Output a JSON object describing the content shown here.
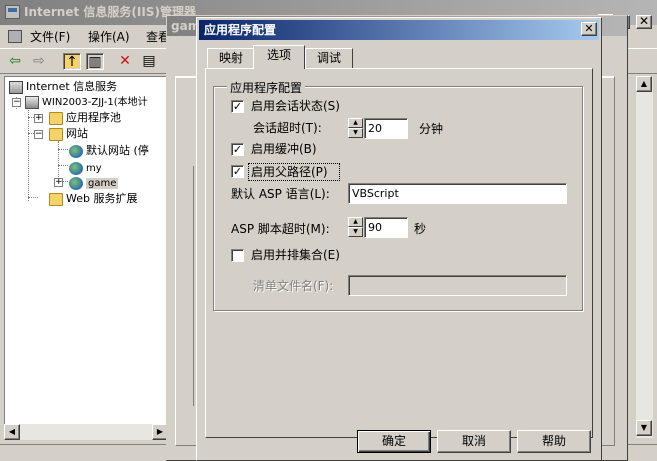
{
  "main_window": {
    "title": "Internet 信息服务(IIS)管理器",
    "menu": [
      "文件(F)",
      "操作(A)",
      "查看"
    ],
    "toolbar_icons": [
      "back-arrow-icon",
      "forward-arrow-icon",
      "up-folder-icon",
      "show-hide-tree-icon",
      "delete-icon",
      "properties-icon"
    ]
  },
  "tree": {
    "root": "Internet 信息服务",
    "server": "WIN2003-ZJJ-1(本地计",
    "app_pools": "应用程序池",
    "websites": "网站",
    "default_site": "默认网站 (停",
    "site_my": "my",
    "site_game": "game",
    "web_ext": "Web 服务扩展"
  },
  "bg_dialog": {
    "title": "game"
  },
  "dialog": {
    "title": "应用程序配置",
    "tabs": [
      "映射",
      "选项",
      "调试"
    ],
    "active_tab": "选项",
    "group_title": "应用程序配置",
    "session_state": {
      "label": "启用会话状态(S)",
      "checked": true
    },
    "session_timeout": {
      "label": "会话超时(T):",
      "value": "20",
      "unit": "分钟"
    },
    "buffering": {
      "label": "启用缓冲(B)",
      "checked": true
    },
    "parent_paths": {
      "label": "启用父路径(P)",
      "checked": true
    },
    "default_language": {
      "label": "默认 ASP 语言(L):",
      "value": "VBScript"
    },
    "script_timeout": {
      "label": "ASP 脚本超时(M):",
      "value": "90",
      "unit": "秒"
    },
    "side_by_side": {
      "label": "启用并排集合(E)",
      "checked": false
    },
    "manifest": {
      "label": "清单文件名(F):",
      "value": ""
    },
    "buttons": {
      "ok": "确定",
      "cancel": "取消",
      "help": "帮助"
    }
  }
}
